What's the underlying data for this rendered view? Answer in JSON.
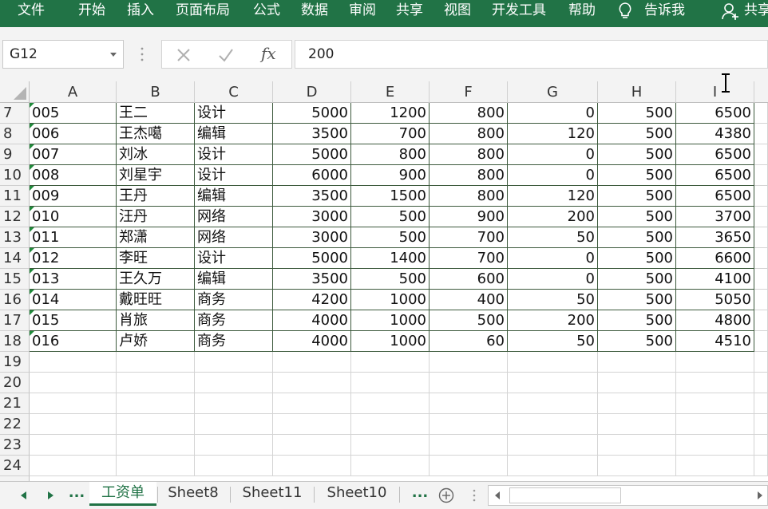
{
  "ribbon": {
    "tabs": [
      "文件",
      "开始",
      "插入",
      "页面布局",
      "公式",
      "数据",
      "审阅",
      "共享",
      "视图",
      "开发工具",
      "帮助"
    ],
    "tell_me": "告诉我",
    "share": "共享"
  },
  "formula_bar": {
    "name_box": "G12",
    "formula": "200"
  },
  "columns": [
    "A",
    "B",
    "C",
    "D",
    "E",
    "F",
    "G",
    "H",
    "I"
  ],
  "rows": [
    {
      "num": "7",
      "cells": [
        "005",
        "王二",
        "设计",
        "5000",
        "1200",
        "800",
        "0",
        "500",
        "6500"
      ]
    },
    {
      "num": "8",
      "cells": [
        "006",
        "王杰噶",
        "编辑",
        "3500",
        "700",
        "800",
        "120",
        "500",
        "4380"
      ]
    },
    {
      "num": "9",
      "cells": [
        "007",
        "刘冰",
        "设计",
        "5000",
        "800",
        "800",
        "0",
        "500",
        "6500"
      ]
    },
    {
      "num": "10",
      "cells": [
        "008",
        "刘星宇",
        "设计",
        "6000",
        "900",
        "800",
        "0",
        "500",
        "6500"
      ]
    },
    {
      "num": "11",
      "cells": [
        "009",
        "王丹",
        "编辑",
        "3500",
        "1500",
        "800",
        "120",
        "500",
        "6500"
      ]
    },
    {
      "num": "12",
      "cells": [
        "010",
        "汪丹",
        "网络",
        "3000",
        "500",
        "900",
        "200",
        "500",
        "3700"
      ]
    },
    {
      "num": "13",
      "cells": [
        "011",
        "郑潇",
        "网络",
        "3000",
        "500",
        "700",
        "50",
        "500",
        "3650"
      ]
    },
    {
      "num": "14",
      "cells": [
        "012",
        "李旺",
        "设计",
        "5000",
        "1400",
        "700",
        "0",
        "500",
        "6600"
      ]
    },
    {
      "num": "15",
      "cells": [
        "013",
        "王久万",
        "编辑",
        "3500",
        "500",
        "600",
        "0",
        "500",
        "4100"
      ]
    },
    {
      "num": "16",
      "cells": [
        "014",
        "戴旺旺",
        "商务",
        "4200",
        "1000",
        "400",
        "50",
        "500",
        "5050"
      ]
    },
    {
      "num": "17",
      "cells": [
        "015",
        "肖旅",
        "商务",
        "4000",
        "1000",
        "500",
        "200",
        "500",
        "4800"
      ]
    },
    {
      "num": "18",
      "cells": [
        "016",
        "卢娇",
        "商务",
        "4000",
        "1000",
        "60",
        "50",
        "500",
        "4510"
      ]
    }
  ],
  "empty_rows": [
    "19",
    "20",
    "21",
    "22",
    "23",
    "24"
  ],
  "sheet_tabs": [
    "工资单",
    "Sheet8",
    "Sheet11",
    "Sheet10"
  ],
  "active_sheet": "工资单",
  "more_label": "...",
  "colors": {
    "accent": "#217346",
    "flag": "#1f8a3a",
    "border": "#3d5a3d"
  }
}
